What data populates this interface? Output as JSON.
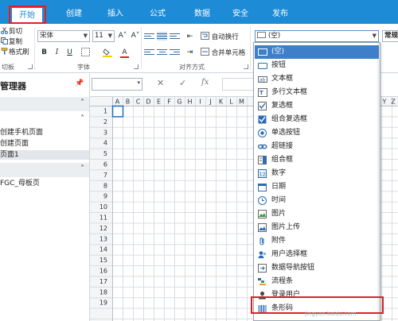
{
  "tabs": [
    {
      "label": "开始",
      "active": true
    },
    {
      "label": "创建",
      "active": false
    },
    {
      "label": "插入",
      "active": false
    },
    {
      "label": "公式",
      "active": false
    },
    {
      "label": "数据",
      "active": false
    },
    {
      "label": "安全",
      "active": false
    },
    {
      "label": "发布",
      "active": false
    }
  ],
  "ribbon": {
    "clipboard": {
      "cut": "剪切",
      "copy": "复制",
      "format_painter": "格式刷",
      "group_label": "切板"
    },
    "font": {
      "family": "宋体",
      "size": "11",
      "grow": "A˄",
      "shrink": "A˅",
      "bold": "B",
      "italic": "I",
      "underline": "U",
      "color_letter": "A",
      "group_label": "字体"
    },
    "alignment": {
      "wrap_text": "自动换行",
      "merge_center": "合并单元格",
      "group_label": "对齐方式"
    },
    "control_select": {
      "value": "(空)"
    },
    "style_truncated": "常规"
  },
  "left_panel": {
    "title": "管理器",
    "section1_items": [
      {
        "label": "创建手机页面",
        "selected": false
      },
      {
        "label": "创建页面",
        "selected": false
      },
      {
        "label": "页面1",
        "selected": true
      }
    ],
    "section2_items": [
      {
        "label": "FGC_母板页",
        "selected": false
      }
    ]
  },
  "formula_bar": {
    "cancel": "✕",
    "enter": "✓",
    "function": "fx"
  },
  "grid": {
    "columns": [
      "A",
      "B",
      "C",
      "D",
      "E",
      "F",
      "G",
      "H",
      "I",
      "J",
      "K",
      "L",
      "M"
    ],
    "far_columns": [
      "Y",
      "Z"
    ],
    "rows": [
      "1",
      "2",
      "3",
      "4",
      "5",
      "6",
      "7",
      "8",
      "9",
      "10",
      "11",
      "12",
      "13",
      "14",
      "15",
      "16",
      "17",
      "18",
      "19"
    ]
  },
  "dropdown": {
    "items": [
      {
        "label": "(空)",
        "icon": "empty-control-icon",
        "highlighted": true
      },
      {
        "label": "按钮",
        "icon": "button-control-icon",
        "highlighted": false
      },
      {
        "label": "文本框",
        "icon": "textbox-control-icon",
        "highlighted": false
      },
      {
        "label": "多行文本框",
        "icon": "multiline-textbox-icon",
        "highlighted": false
      },
      {
        "label": "复选框",
        "icon": "checkbox-control-icon",
        "highlighted": false
      },
      {
        "label": "组合复选框",
        "icon": "checkbox-group-icon",
        "highlighted": false
      },
      {
        "label": "单选按钮",
        "icon": "radio-button-icon",
        "highlighted": false
      },
      {
        "label": "超链接",
        "icon": "hyperlink-icon",
        "highlighted": false
      },
      {
        "label": "组合框",
        "icon": "combobox-icon",
        "highlighted": false
      },
      {
        "label": "数字",
        "icon": "number-control-icon",
        "highlighted": false
      },
      {
        "label": "日期",
        "icon": "date-control-icon",
        "highlighted": false
      },
      {
        "label": "时间",
        "icon": "time-control-icon",
        "highlighted": false
      },
      {
        "label": "图片",
        "icon": "image-control-icon",
        "highlighted": false
      },
      {
        "label": "图片上传",
        "icon": "image-upload-icon",
        "highlighted": false
      },
      {
        "label": "附件",
        "icon": "attachment-icon",
        "highlighted": false
      },
      {
        "label": "用户选择框",
        "icon": "user-picker-icon",
        "highlighted": false
      },
      {
        "label": "数据导航按钮",
        "icon": "data-navigation-icon",
        "highlighted": false
      },
      {
        "label": "流程条",
        "icon": "workflow-bar-icon",
        "highlighted": false
      },
      {
        "label": "登录用户",
        "icon": "login-user-icon",
        "highlighted": false
      },
      {
        "label": "条形码",
        "icon": "barcode-icon",
        "highlighted": false
      }
    ]
  },
  "watermark": "jingyan.baidu.com",
  "colors": {
    "tab_bar": "#1d8bd6",
    "highlight": "#3d7fc9",
    "annotation_red": "#e02020",
    "active_cell": "#1d6fc4"
  }
}
